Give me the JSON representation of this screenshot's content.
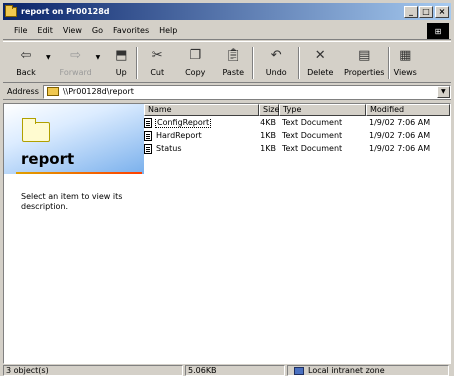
{
  "window": {
    "title": "report on Pr00128d",
    "buttons": {
      "minimize": "_",
      "maximize": "□",
      "close": "×"
    }
  },
  "menu": {
    "items": [
      "File",
      "Edit",
      "View",
      "Go",
      "Favorites",
      "Help"
    ]
  },
  "toolbar": {
    "back": {
      "label": "Back",
      "icon": "back-arrow-icon"
    },
    "forward": {
      "label": "Forward",
      "icon": "forward-arrow-icon"
    },
    "up": {
      "label": "Up",
      "icon": "up-folder-icon"
    },
    "cut": {
      "label": "Cut",
      "icon": "scissors-icon"
    },
    "copy": {
      "label": "Copy",
      "icon": "copy-icon"
    },
    "paste": {
      "label": "Paste",
      "icon": "paste-icon"
    },
    "undo": {
      "label": "Undo",
      "icon": "undo-icon"
    },
    "delete": {
      "label": "Delete",
      "icon": "delete-x-icon"
    },
    "properties": {
      "label": "Properties",
      "icon": "properties-icon"
    },
    "views": {
      "label": "Views",
      "icon": "views-icon"
    }
  },
  "address": {
    "label": "Address",
    "value": "\\\\Pr00128d\\report"
  },
  "leftpanel": {
    "title": "report",
    "description": "Select an item to view its description."
  },
  "list": {
    "columns": {
      "name": "Name",
      "size": "Size",
      "type": "Type",
      "modified": "Modified"
    },
    "rows": [
      {
        "name": "ConfigReport",
        "size": "4KB",
        "type": "Text Document",
        "modified": "1/9/02 7:06 AM"
      },
      {
        "name": "HardReport",
        "size": "1KB",
        "type": "Text Document",
        "modified": "1/9/02 7:06 AM"
      },
      {
        "name": "Status",
        "size": "1KB",
        "type": "Text Document",
        "modified": "1/9/02 7:06 AM"
      }
    ]
  },
  "status": {
    "objects": "3 object(s)",
    "size": "5.06KB",
    "zone": "Local intranet zone"
  }
}
